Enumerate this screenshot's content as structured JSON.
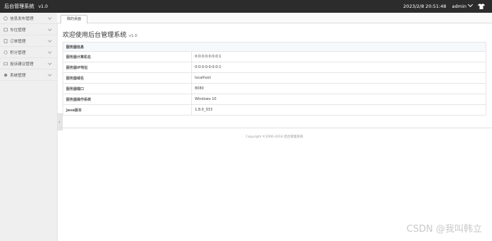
{
  "header": {
    "brand": "后台管理系统",
    "version": "v1.0",
    "datetime": "2023/2/8 20:51:48",
    "user": "admin"
  },
  "sidebar": {
    "items": [
      {
        "label": "信息发布管理",
        "icon": "info-icon"
      },
      {
        "label": "车位管理",
        "icon": "parking-icon"
      },
      {
        "label": "订单管理",
        "icon": "order-icon"
      },
      {
        "label": "积分管理",
        "icon": "points-icon"
      },
      {
        "label": "投诉建议管理",
        "icon": "feedback-icon"
      },
      {
        "label": "系统管理",
        "icon": "settings-icon"
      }
    ]
  },
  "tabs": [
    {
      "label": "我的桌面"
    }
  ],
  "main": {
    "welcome_title": "欢迎使用后台管理系统",
    "welcome_version": "v1.0",
    "table_header": "服务器信息",
    "rows": [
      {
        "key": "服务器计算机名",
        "value": "0:0:0:0:0:0:0:1"
      },
      {
        "key": "服务器IP地址",
        "value": "0:0:0:0:0:0:0:1"
      },
      {
        "key": "服务器域名",
        "value": "localhost"
      },
      {
        "key": "服务器端口",
        "value": "8080"
      },
      {
        "key": "服务器操作系统",
        "value": "Windows 10"
      },
      {
        "key": "Java版本",
        "value": "1.8.0_333"
      }
    ]
  },
  "footer": {
    "copyright": "Copyright ©2006-2018 后台管理系统"
  },
  "watermark": "CSDN @我叫韩立",
  "colors": {
    "topbar": "#2c2c2c",
    "sidebar": "#efefef",
    "table_header_bg": "#f6f9fc"
  }
}
